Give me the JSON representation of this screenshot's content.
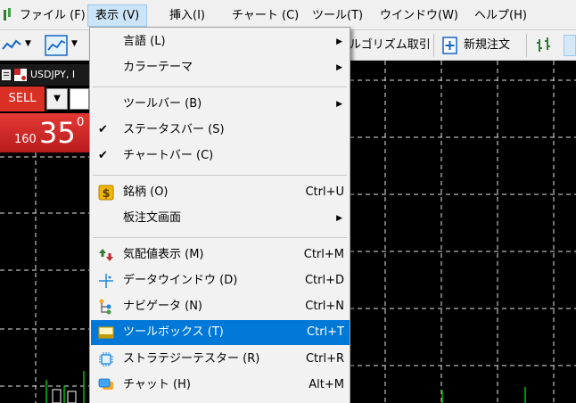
{
  "menubar": {
    "items": [
      {
        "label": "ファイル (F)"
      },
      {
        "label": "表示 (V)"
      },
      {
        "label": "挿入(I)"
      },
      {
        "label": "チャート (C)"
      },
      {
        "label": "ツール(T)"
      },
      {
        "label": "ウインドウ(W)"
      },
      {
        "label": "ヘルプ(H)"
      }
    ]
  },
  "toolbar": {
    "algo_label": "ルゴリズム取引",
    "new_order_label": "新規注文"
  },
  "symbol": {
    "name": "USDJPY, I",
    "sell_label": "SELL",
    "price_small": "160",
    "price_big": "35",
    "price_sup": "0"
  },
  "view_menu": {
    "items": [
      {
        "label": "言語 (L)",
        "shortcut": "",
        "submenu": true
      },
      {
        "label": "カラーテーマ",
        "shortcut": "",
        "submenu": true
      },
      {
        "label": "ツールバー (B)",
        "shortcut": "",
        "submenu": true
      },
      {
        "label": "ステータスバー (S)",
        "shortcut": "",
        "checked": true
      },
      {
        "label": "チャートバー (C)",
        "shortcut": "",
        "checked": true
      },
      {
        "label": "銘柄 (O)",
        "shortcut": "Ctrl+U",
        "icon": "symbols-icon"
      },
      {
        "label": "板注文画面",
        "shortcut": "",
        "submenu": true
      },
      {
        "label": "気配値表示 (M)",
        "shortcut": "Ctrl+M",
        "icon": "market-watch-icon"
      },
      {
        "label": "データウインドウ (D)",
        "shortcut": "Ctrl+D",
        "icon": "crosshair-icon"
      },
      {
        "label": "ナビゲータ (N)",
        "shortcut": "Ctrl+N",
        "icon": "navigator-icon"
      },
      {
        "label": "ツールボックス (T)",
        "shortcut": "Ctrl+T",
        "icon": "toolbox-icon",
        "highlighted": true
      },
      {
        "label": "ストラテジーテスター (R)",
        "shortcut": "Ctrl+R",
        "icon": "tester-chip-icon"
      },
      {
        "label": "チャット (H)",
        "shortcut": "Alt+M",
        "icon": "chat-icon"
      }
    ]
  },
  "colors": {
    "menu_highlight": "#0078d7",
    "chart_bg": "#000000",
    "grid": "#ffffff",
    "candle_up": "#00c000",
    "sell": "#d93025"
  }
}
